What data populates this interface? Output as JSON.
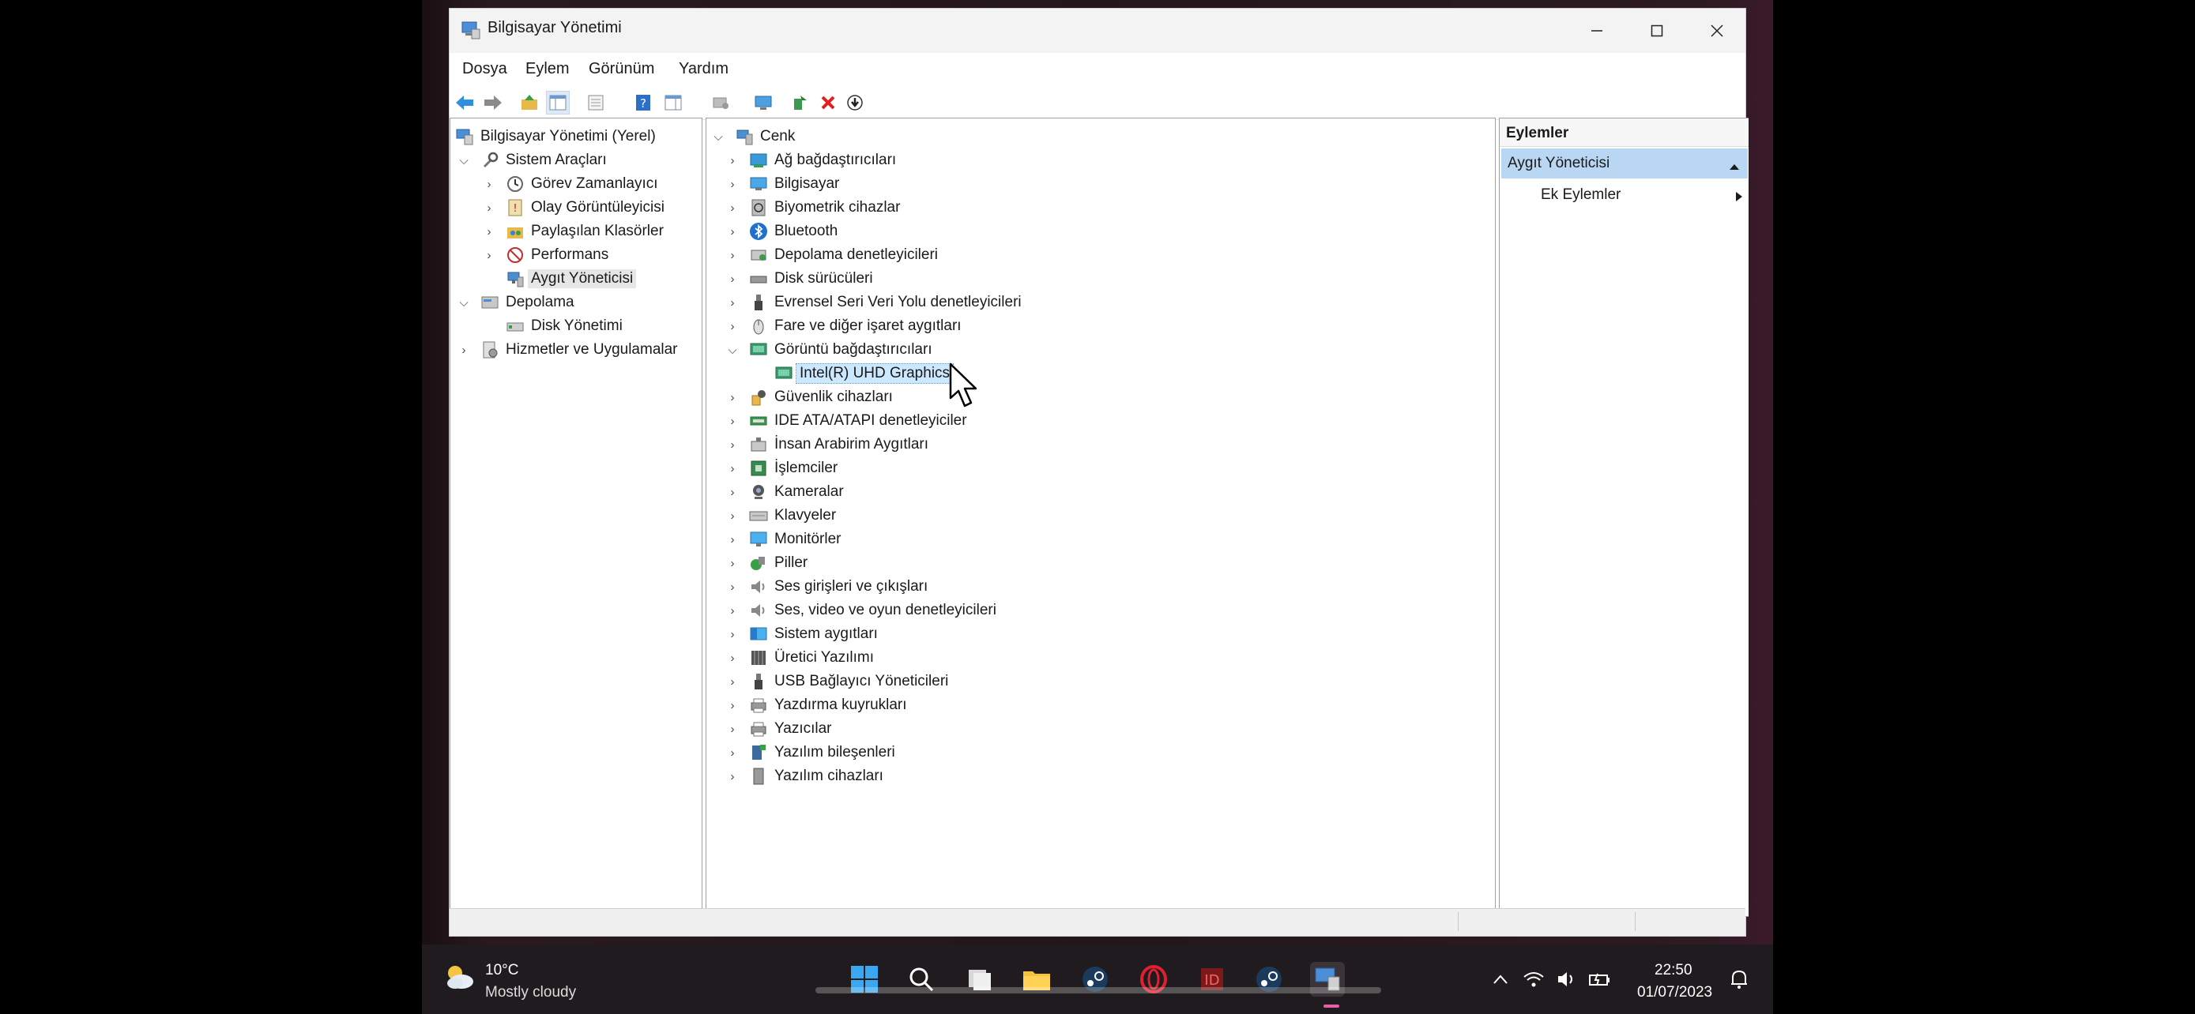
{
  "window": {
    "title": "Bilgisayar Yönetimi"
  },
  "menu": [
    "Dosya",
    "Eylem",
    "Görünüm",
    "Yardım"
  ],
  "left_tree": {
    "root": "Bilgisayar Yönetimi (Yerel)",
    "sistem": "Sistem Araçları",
    "gorev": "Görev Zamanlayıcı",
    "olay": "Olay Görüntüleyicisi",
    "paylasilan": "Paylaşılan Klasörler",
    "performans": "Performans",
    "aygit": "Aygıt Yöneticisi",
    "depolama": "Depolama",
    "disk": "Disk Yönetimi",
    "hizmetler": "Hizmetler ve Uygulamalar"
  },
  "device_tree": {
    "root": "Cenk",
    "categories": [
      "Ağ bağdaştırıcıları",
      "Bilgisayar",
      "Biyometrik cihazlar",
      "Bluetooth",
      "Depolama denetleyicileri",
      "Disk sürücüleri",
      "Evrensel Seri Veri Yolu denetleyicileri",
      "Fare ve diğer işaret aygıtları",
      "Görüntü bağdaştırıcıları",
      "Güvenlik cihazları",
      "IDE ATA/ATAPI denetleyiciler",
      "İnsan Arabirim Aygıtları",
      "İşlemciler",
      "Kameralar",
      "Klavyeler",
      "Monitörler",
      "Piller",
      "Ses girişleri ve çıkışları",
      "Ses, video ve oyun denetleyicileri",
      "Sistem aygıtları",
      "Üretici Yazılımı",
      "USB Bağlayıcı Yöneticileri",
      "Yazdırma kuyrukları",
      "Yazıcılar",
      "Yazılım bileşenleri",
      "Yazılım cihazları"
    ],
    "expanded_child": "Intel(R) UHD Graphics"
  },
  "actions": {
    "header": "Eylemler",
    "selected": "Aygıt Yöneticisi",
    "more": "Ek Eylemler"
  },
  "taskbar": {
    "temperature": "10°C",
    "weather": "Mostly cloudy",
    "time": "22:50",
    "date": "01/07/2023"
  },
  "colors": {
    "selection": "#cce8ff",
    "action_selected": "#b9d7f3",
    "taskbar": "#1f1b1e"
  }
}
